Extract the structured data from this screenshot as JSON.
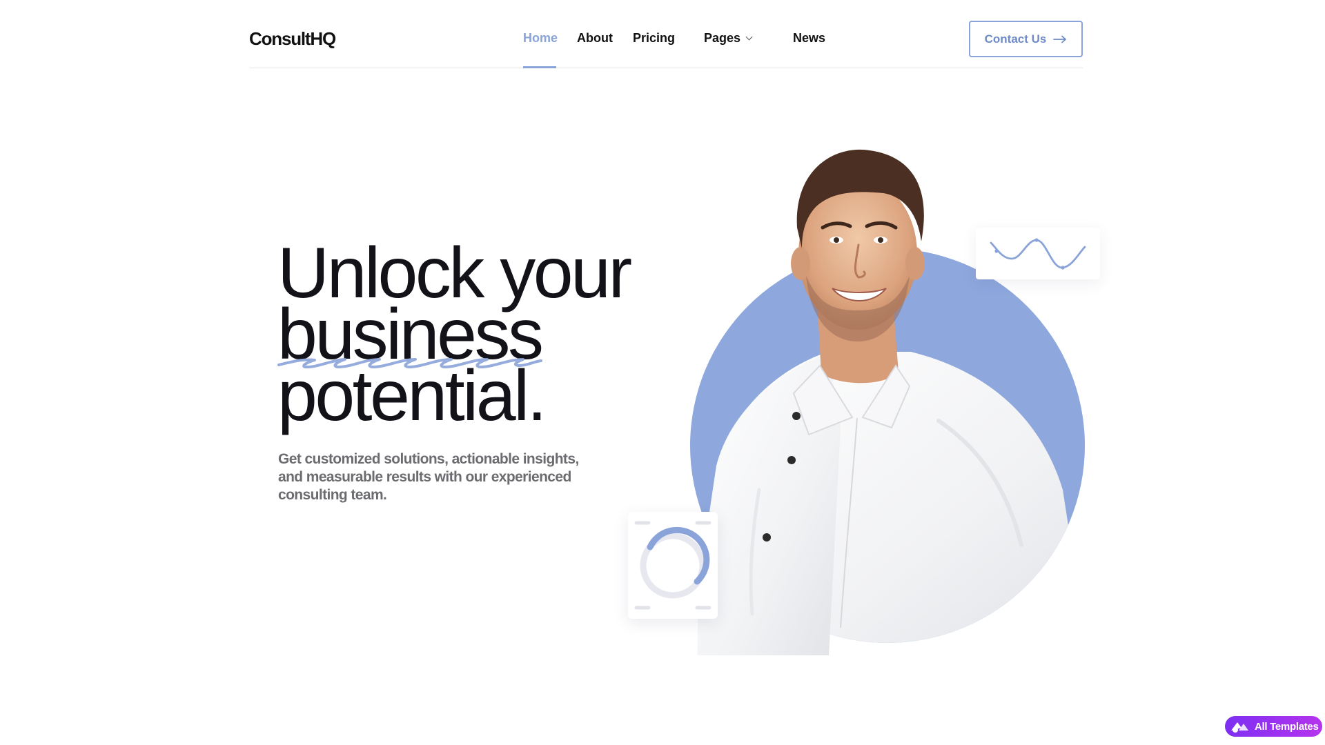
{
  "header": {
    "logo": "ConsultHQ",
    "nav": [
      {
        "label": "Home",
        "active": true
      },
      {
        "label": "About",
        "active": false
      },
      {
        "label": "Pricing",
        "active": false
      },
      {
        "label": "Pages",
        "active": false,
        "has_dropdown": true
      },
      {
        "label": "News",
        "active": false
      }
    ],
    "contact_label": "Contact Us",
    "contact_icon": "arrow-right-icon"
  },
  "hero": {
    "title_lines": [
      "Unlock your",
      "business",
      "potential."
    ],
    "subtitle": "Get customized solutions, actionable insights, and measurable results with our experienced consulting team."
  },
  "badge": {
    "label": "All Templates",
    "icon": "templates-logo-icon"
  },
  "colors": {
    "accent": "#8aa3d9",
    "accent_dark": "#6e8ac8",
    "heading": "#121218",
    "body_text": "#6b6b70",
    "badge_start": "#7d2ff2",
    "badge_end": "#b534ee"
  }
}
